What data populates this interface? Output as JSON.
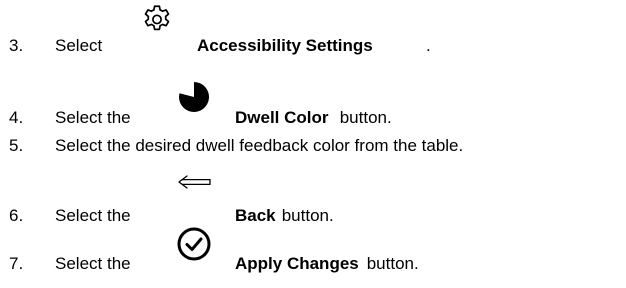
{
  "steps": [
    {
      "number": "3.",
      "before": "Select",
      "icon": "gear-icon",
      "bold": "Accessibility Settings",
      "after": "."
    },
    {
      "number": "4.",
      "before": "Select the",
      "icon": "dwell-pie-icon",
      "bold": "Dwell Color",
      "after": " button."
    },
    {
      "number": "5.",
      "text": "Select the desired dwell feedback color from the table."
    },
    {
      "number": "6.",
      "before": "Select the",
      "icon": "back-arrow-icon",
      "bold": "Back",
      "after": " button."
    },
    {
      "number": "7.",
      "before": "Select the",
      "icon": "checkmark-circle-icon",
      "bold": "Apply Changes",
      "after": " button."
    }
  ]
}
